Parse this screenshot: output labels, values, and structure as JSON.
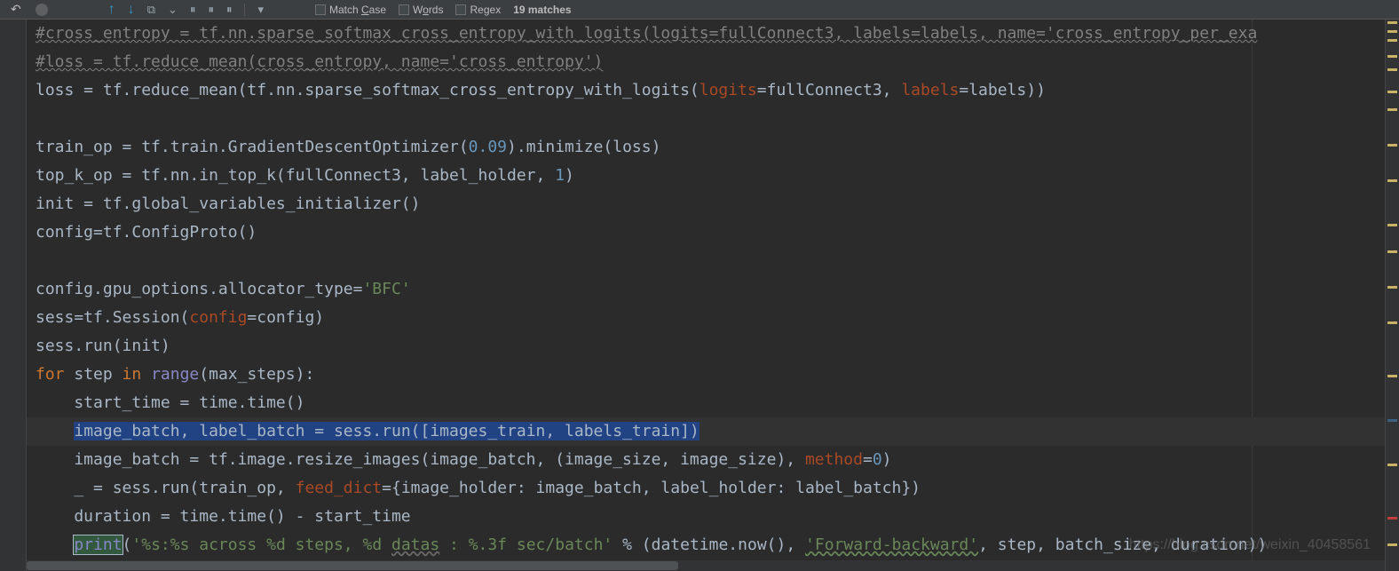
{
  "findbar": {
    "match_case_label_pre": "Match ",
    "match_case_label_u": "C",
    "match_case_label_post": "ase",
    "words_label_pre": "W",
    "words_label_u": "o",
    "words_label_post": "rds",
    "regex_label_pre": "Re",
    "regex_label_u": "g",
    "regex_label_post": "ex",
    "matches_text": "19 matches"
  },
  "icons": {
    "prev": "↶",
    "close": "✕",
    "up": "↑",
    "down": "↓",
    "tool1": "⧉",
    "tool2": "⌄",
    "pause1": "⏸",
    "pause2": "⏸",
    "pause3": "⏸",
    "filter": "▾"
  },
  "code": {
    "l1_a": "#cross_entropy = tf.nn.sparse_softmax_cross_entropy_with_logits(logits=fullConnect3, labels=labels, name='cross_entropy_per_exa",
    "l2_a": "#loss = tf.reduce_mean(cross_entropy, name='cross_entropy')",
    "l3_a": "loss = tf.reduce_mean(tf.nn.sparse_softmax_cross_entropy_with_logits(",
    "l3_kw1": "logits",
    "l3_b": "=fullConnect3, ",
    "l3_kw2": "labels",
    "l3_c": "=labels))",
    "l5_a": "train_op = tf.train.GradientDescentOptimizer(",
    "l5_num": "0.09",
    "l5_b": ").minimize(loss)",
    "l6_a": "top_k_op = tf.nn.in_top_k(fullConnect3, label_holder, ",
    "l6_num": "1",
    "l6_b": ")",
    "l7_a": "init = tf.global_variables_initializer()",
    "l8_a": "config=tf.ConfigProto()",
    "l10_a": "config.gpu_options.allocator_type=",
    "l10_str": "'BFC'",
    "l11_a": "sess=tf.Session(",
    "l11_kw": "config",
    "l11_b": "=config)",
    "l12_a": "sess.run(init)",
    "l13_for": "for",
    "l13_a": " step ",
    "l13_in": "in",
    "l13_b": " ",
    "l13_range": "range",
    "l13_c": "(max_steps):",
    "l14_a": "    start_time = time.time()",
    "l15_a": "    ",
    "l15_sel": "image_batch, label_batch = sess.run([images_train, labels_train])",
    "l16_a": "    image_batch = tf.image.resize_images(image_batch, (image_size, image_size), ",
    "l16_kw": "method",
    "l16_b": "=",
    "l16_num": "0",
    "l16_c": ")",
    "l17_a": "    _ = sess.run(train_op, ",
    "l17_kw": "feed_dict",
    "l17_b": "={image_holder: image_batch, label_holder: label_batch})",
    "l18_a": "    duration = time.time() - start_time",
    "l19_a": "    ",
    "l19_print": "print",
    "l19_b": "(",
    "l19_str1": "'%s:%s across %d steps, %d ",
    "l19_datas": "datas",
    "l19_str2": " : %.3f sec/batch'",
    "l19_c": " % (datetime.now(), ",
    "l19_str3": "'Forward-backward'",
    "l19_d": ", step, batch_size, duration))"
  },
  "watermark": "https://blog.csdn.net/weixin_40458561"
}
